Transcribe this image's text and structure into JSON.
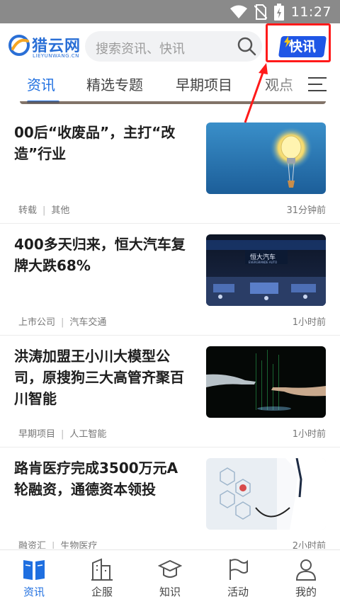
{
  "status_bar": {
    "time": "11:27"
  },
  "header": {
    "logo_text": "猎云网",
    "logo_sub": "LIEYUNWANG.CN",
    "search_placeholder": "搜索资讯、快讯",
    "flash_label": "快讯"
  },
  "tabs": [
    {
      "label": "资讯",
      "active": true
    },
    {
      "label": "精选专题"
    },
    {
      "label": "早期项目"
    },
    {
      "label": "观点"
    }
  ],
  "news": [
    {
      "title": "00后“收废品”，主打“改造”行业",
      "source": "转载",
      "category": "其他",
      "time": "31分钟前"
    },
    {
      "title": "400多天归来，恒大汽车复牌大跌68%",
      "source": "上市公司",
      "category": "汽车交通",
      "time": "1小时前"
    },
    {
      "title": "洪涛加盟王小川大模型公司，原搜狗三大高管齐聚百川智能",
      "source": "早期项目",
      "category": "人工智能",
      "time": "1小时前"
    },
    {
      "title": "路肯医疗完成3500万元A轮融资，通德资本领投",
      "source": "融资汇",
      "category": "生物医疗",
      "time": "2小时前"
    }
  ],
  "thumb_text": {
    "evergrande_sign": "恒大汽车",
    "evergrande_sign_en": "EVERGRANDE AUTO"
  },
  "bottom_nav": [
    {
      "label": "资讯",
      "icon": "book-icon",
      "active": true
    },
    {
      "label": "企服",
      "icon": "building-icon"
    },
    {
      "label": "知识",
      "icon": "graduation-cap-icon"
    },
    {
      "label": "活动",
      "icon": "flag-icon"
    },
    {
      "label": "我的",
      "icon": "person-icon"
    }
  ],
  "colors": {
    "accent": "#1f6fe0",
    "flash_button": "#1f56e6",
    "highlight": "#ff1a1a"
  }
}
